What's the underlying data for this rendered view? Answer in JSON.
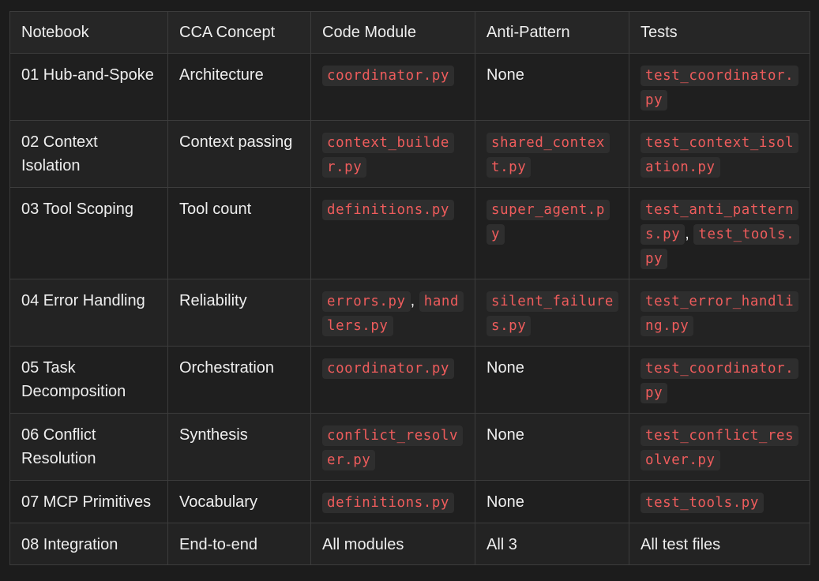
{
  "table": {
    "headers": [
      "Notebook",
      "CCA Concept",
      "Code Module",
      "Anti-Pattern",
      "Tests"
    ],
    "rows": [
      {
        "notebook": "01 Hub-and-Spoke",
        "concept": "Architecture",
        "code_module": [
          {
            "code": "coordinator.py"
          }
        ],
        "anti_pattern": [
          {
            "text": "None"
          }
        ],
        "tests": [
          {
            "code": "test_coordinator.py"
          }
        ]
      },
      {
        "notebook": "02 Context Isolation",
        "concept": "Context passing",
        "code_module": [
          {
            "code": "context_builder.py"
          }
        ],
        "anti_pattern": [
          {
            "code": "shared_context.py"
          }
        ],
        "tests": [
          {
            "code": "test_context_isolation.py"
          }
        ]
      },
      {
        "notebook": "03 Tool Scoping",
        "concept": "Tool count",
        "code_module": [
          {
            "code": "definitions.py"
          }
        ],
        "anti_pattern": [
          {
            "code": "super_agent.py"
          }
        ],
        "tests": [
          {
            "code": "test_anti_patterns.py"
          },
          {
            "sep": ", "
          },
          {
            "code": "test_tools.py"
          }
        ]
      },
      {
        "notebook": "04 Error Handling",
        "concept": "Reliability",
        "code_module": [
          {
            "code": "errors.py"
          },
          {
            "sep": ", "
          },
          {
            "code": "handlers.py"
          }
        ],
        "anti_pattern": [
          {
            "code": "silent_failures.py"
          }
        ],
        "tests": [
          {
            "code": "test_error_handling.py"
          }
        ]
      },
      {
        "notebook": "05 Task Decomposition",
        "concept": "Orchestration",
        "code_module": [
          {
            "code": "coordinator.py"
          }
        ],
        "anti_pattern": [
          {
            "text": "None"
          }
        ],
        "tests": [
          {
            "code": "test_coordinator.py"
          }
        ]
      },
      {
        "notebook": "06 Conflict Resolution",
        "concept": "Synthesis",
        "code_module": [
          {
            "code": "conflict_resolver.py"
          }
        ],
        "anti_pattern": [
          {
            "text": "None"
          }
        ],
        "tests": [
          {
            "code": "test_conflict_resolver.py"
          }
        ]
      },
      {
        "notebook": "07 MCP Primitives",
        "concept": "Vocabulary",
        "code_module": [
          {
            "code": "definitions.py"
          }
        ],
        "anti_pattern": [
          {
            "text": "None"
          }
        ],
        "tests": [
          {
            "code": "test_tools.py"
          }
        ]
      },
      {
        "notebook": "08 Integration",
        "concept": "End-to-end",
        "code_module": [
          {
            "text": "All modules"
          }
        ],
        "anti_pattern": [
          {
            "text": "All 3"
          }
        ],
        "tests": [
          {
            "text": "All test files"
          }
        ]
      }
    ]
  },
  "colors": {
    "code_text": "#ef5c5c",
    "code_bg": "#2e2e2e",
    "border": "#3c3c3c",
    "background": "#1c1c1c"
  }
}
